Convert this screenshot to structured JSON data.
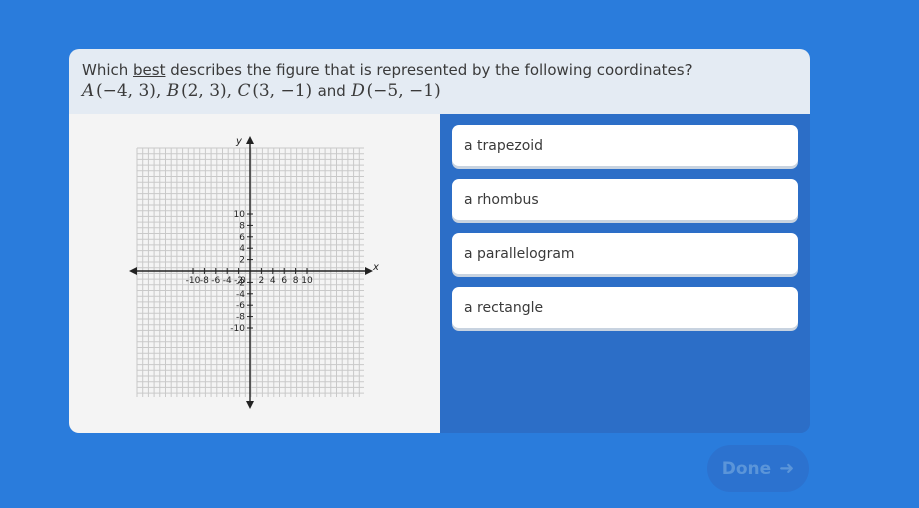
{
  "question": {
    "prefix": "Which ",
    "emphasis": "best",
    "suffix": " describes the figure that is represented by the following coordinates?",
    "points": [
      {
        "label": "A",
        "coords": "(−4, 3)"
      },
      {
        "label": "B",
        "coords": "(2, 3)"
      },
      {
        "label": "C",
        "coords": "(3, −1)"
      },
      {
        "label": "D",
        "coords": "(−5, −1)"
      }
    ],
    "and_word": "and"
  },
  "graph": {
    "x_axis_label": "x",
    "y_axis_label": "y",
    "range": [
      -10,
      10
    ],
    "x_ticks": [
      "-10",
      "-8",
      "-6",
      "-4",
      "-2",
      "0",
      "2",
      "4",
      "6",
      "8",
      "10"
    ],
    "y_ticks": [
      "10",
      "8",
      "6",
      "4",
      "2",
      "-2",
      "-4",
      "-6",
      "-8",
      "-10"
    ]
  },
  "choices": [
    "a trapezoid",
    "a rhombus",
    "a parallelogram",
    "a rectangle"
  ],
  "done": {
    "label": "Done",
    "icon": "arrow-right-icon"
  },
  "colors": {
    "background": "#2a7cdc",
    "question_bg": "#e4ebf3",
    "choice_panel": "#2c6ec7"
  }
}
